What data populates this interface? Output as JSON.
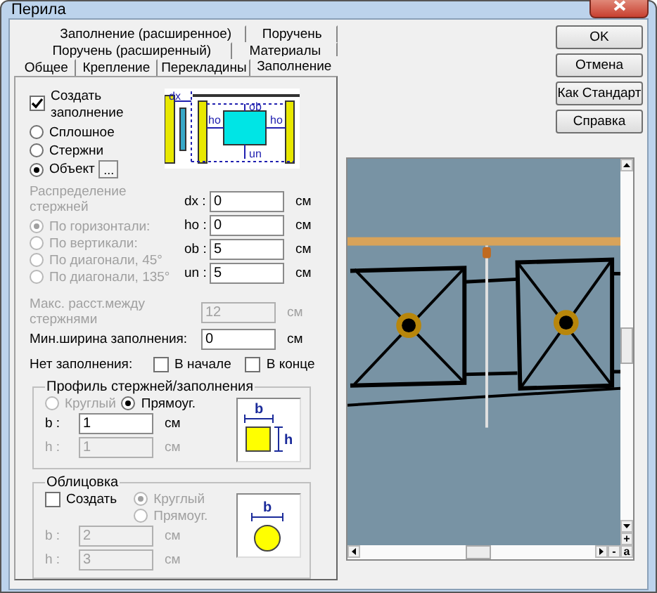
{
  "window": {
    "title": "Перила"
  },
  "tab_rows": [
    [
      {
        "label": "Заполнение (расширенное)",
        "selected": false
      },
      {
        "label": "Поручень",
        "selected": false
      }
    ],
    [
      {
        "label": "Поручень (расширенный)",
        "selected": false
      },
      {
        "label": "Материалы",
        "selected": false
      }
    ],
    [
      {
        "label": "Общее",
        "selected": false
      },
      {
        "label": "Крепление",
        "selected": false
      },
      {
        "label": "Перекладины",
        "selected": false
      },
      {
        "label": "Заполнение",
        "selected": true
      }
    ]
  ],
  "create_fill": {
    "label": "Создать заполнение",
    "checked": true
  },
  "fill_types": [
    {
      "label": "Сплошное",
      "selected": false
    },
    {
      "label": "Стержни",
      "selected": false
    },
    {
      "label": "Объект",
      "selected": true
    }
  ],
  "object_button": "...",
  "diagram_labels": [
    "dx",
    "ob",
    "ho",
    "ho",
    "un"
  ],
  "distribution": {
    "label": "Распределение стержней",
    "options": [
      {
        "label": "По горизонтали:",
        "selected": true,
        "disabled": true
      },
      {
        "label": "По вертикали:",
        "selected": false,
        "disabled": true
      },
      {
        "label": "По диагонали, 45°",
        "selected": false,
        "disabled": true
      },
      {
        "label": "По диагонали, 135°",
        "selected": false,
        "disabled": true
      }
    ]
  },
  "offsets": [
    {
      "label": "dx :",
      "value": "0",
      "unit": "см",
      "disabled": false
    },
    {
      "label": "ho :",
      "value": "0",
      "unit": "см",
      "disabled": false
    },
    {
      "label": "ob :",
      "value": "5",
      "unit": "см",
      "disabled": false
    },
    {
      "label": "un :",
      "value": "5",
      "unit": "см",
      "disabled": false
    }
  ],
  "max_spacing": {
    "label": "Макс. расст.между стержнями",
    "value": "12",
    "unit": "см",
    "disabled": true
  },
  "min_width": {
    "label": "Мин.ширина заполнения:",
    "value": "0",
    "unit": "см",
    "disabled": false
  },
  "no_fill": {
    "label": "Нет заполнения:",
    "options": [
      {
        "label": "В начале",
        "checked": false
      },
      {
        "label": "В конце",
        "checked": false
      }
    ]
  },
  "profile": {
    "title": "Профиль стержней/заполнения",
    "shapes": [
      {
        "label": "Круглый",
        "selected": false,
        "disabled": true
      },
      {
        "label": "Прямоуг.",
        "selected": true,
        "disabled": false
      }
    ],
    "fields": [
      {
        "label": "b :",
        "value": "1",
        "unit": "см",
        "disabled": false
      },
      {
        "label": "h :",
        "value": "1",
        "unit": "см",
        "disabled": true
      }
    ],
    "diagram": {
      "kind": "rect",
      "labels": [
        "b",
        "h"
      ]
    }
  },
  "cladding": {
    "title": "Облицовка",
    "create": {
      "label": "Создать",
      "checked": false
    },
    "shapes": [
      {
        "label": "Круглый",
        "selected": true,
        "disabled": true
      },
      {
        "label": "Прямоуг.",
        "selected": false,
        "disabled": true
      }
    ],
    "fields": [
      {
        "label": "b :",
        "value": "2",
        "unit": "см",
        "disabled": true
      },
      {
        "label": "h :",
        "value": "3",
        "unit": "см",
        "disabled": true
      }
    ],
    "diagram": {
      "kind": "circle",
      "labels": [
        "b"
      ]
    }
  },
  "buttons": [
    "OK",
    "Отмена",
    "Как Стандарт",
    "Справка"
  ],
  "preview": {
    "kind": "picture",
    "zoom_buttons": [
      "+",
      "-",
      "a"
    ]
  }
}
